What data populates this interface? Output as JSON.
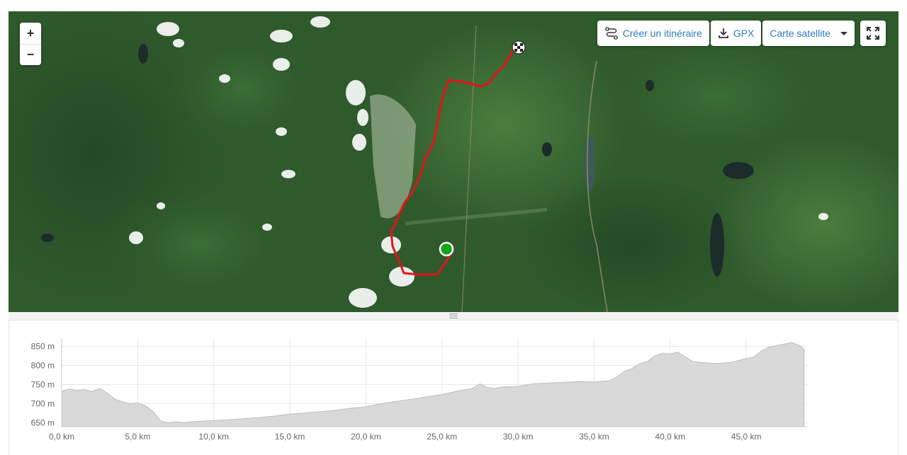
{
  "map": {
    "zoom_in_label": "+",
    "zoom_out_label": "−",
    "create_route_label": "Créer un itinéraire",
    "gpx_label": "GPX",
    "basemap_label": "Carte satellite",
    "icons": {
      "create_route": "route-icon",
      "gpx": "download-icon",
      "basemap": "caret-down-icon",
      "fullscreen": "fullscreen-icon",
      "start": "start-marker",
      "finish": "finish-flag-marker"
    },
    "colors": {
      "route": "#e3121b",
      "start": "#11a51b",
      "accent": "#2e7bbf"
    }
  },
  "chart_data": {
    "type": "area",
    "xlabel": "",
    "ylabel": "",
    "xlim": [
      0,
      49
    ],
    "ylim": [
      640,
      860
    ],
    "x_ticks": [
      "0,0 km",
      "5,0 km",
      "10,0 km",
      "15,0 km",
      "20,0 km",
      "25,0 km",
      "30,0 km",
      "35,0 km",
      "40,0 km",
      "45,0 km"
    ],
    "x_tick_values": [
      0,
      5,
      10,
      15,
      20,
      25,
      30,
      35,
      40,
      45
    ],
    "y_ticks": [
      "650 m",
      "700 m",
      "750 m",
      "800 m",
      "850 m"
    ],
    "y_tick_values": [
      650,
      700,
      750,
      800,
      850
    ],
    "grid": true,
    "series": [
      {
        "x": [
          0,
          0.5,
          1,
          1.5,
          2,
          2.5,
          3,
          3.5,
          4,
          4.5,
          5,
          5.5,
          6,
          6.5,
          7,
          7.5,
          8,
          9,
          10,
          11,
          12,
          13,
          14,
          15,
          16,
          17,
          18,
          19,
          20,
          21,
          22,
          23,
          24,
          25,
          26,
          27,
          27.5,
          28,
          28.5,
          29,
          30,
          31,
          32,
          33,
          34,
          35,
          36,
          36.5,
          37,
          37.5,
          38,
          38.5,
          39,
          39.5,
          40,
          40.5,
          41,
          41.5,
          42,
          43,
          44,
          45,
          45.5,
          46,
          46.5,
          47,
          47.5,
          48,
          48.5,
          48.8
        ],
        "y": [
          733,
          738,
          735,
          737,
          732,
          740,
          728,
          712,
          705,
          700,
          702,
          695,
          680,
          655,
          650,
          653,
          651,
          654,
          656,
          658,
          661,
          664,
          668,
          673,
          676,
          679,
          683,
          688,
          692,
          700,
          706,
          712,
          718,
          724,
          733,
          740,
          752,
          742,
          740,
          744,
          745,
          752,
          754,
          756,
          758,
          757,
          760,
          770,
          785,
          792,
          805,
          810,
          825,
          832,
          830,
          835,
          822,
          810,
          808,
          805,
          808,
          818,
          822,
          838,
          848,
          852,
          856,
          860,
          852,
          842
        ]
      }
    ]
  }
}
